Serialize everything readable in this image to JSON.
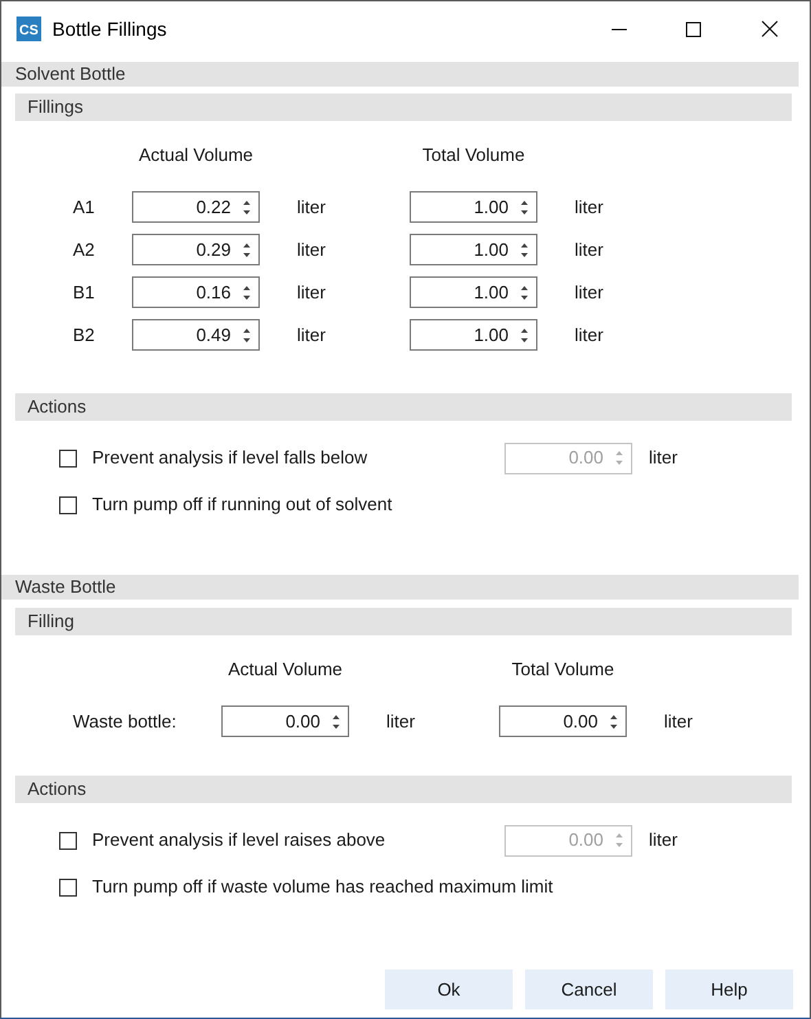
{
  "window": {
    "title": "Bottle Fillings",
    "icon_text": "CS"
  },
  "sections": [
    {
      "title": "Solvent Bottle",
      "filling": {
        "title": "Fillings",
        "kind": "compact",
        "columns": [
          "Actual Volume",
          "Total Volume"
        ],
        "rows": [
          {
            "label": "A1",
            "actual": "0.22",
            "actual_unit": "liter",
            "total": "1.00",
            "total_unit": "liter"
          },
          {
            "label": "A2",
            "actual": "0.29",
            "actual_unit": "liter",
            "total": "1.00",
            "total_unit": "liter"
          },
          {
            "label": "B1",
            "actual": "0.16",
            "actual_unit": "liter",
            "total": "1.00",
            "total_unit": "liter"
          },
          {
            "label": "B2",
            "actual": "0.49",
            "actual_unit": "liter",
            "total": "1.00",
            "total_unit": "liter"
          }
        ]
      },
      "actions": {
        "title": "Actions",
        "items": [
          {
            "kind": "threshold",
            "label": "Prevent analysis if level falls below",
            "checked": false,
            "value": "0.00",
            "disabled": true,
            "unit": "liter"
          },
          {
            "kind": "plain",
            "label": "Turn pump off if running out of solvent",
            "checked": false
          }
        ]
      }
    },
    {
      "title": "Waste Bottle",
      "filling": {
        "title": "Filling",
        "kind": "wide",
        "columns": [
          "Actual Volume",
          "Total Volume"
        ],
        "rows": [
          {
            "label": "Waste bottle:",
            "actual": "0.00",
            "actual_unit": "liter",
            "total": "0.00",
            "total_unit": "liter"
          }
        ]
      },
      "actions": {
        "title": "Actions",
        "items": [
          {
            "kind": "threshold",
            "label": "Prevent analysis if level raises above",
            "checked": false,
            "value": "0.00",
            "disabled": true,
            "unit": "liter"
          },
          {
            "kind": "plain",
            "label": "Turn pump off if waste volume has reached maximum limit",
            "checked": false
          }
        ]
      }
    }
  ],
  "buttons": [
    "Ok",
    "Cancel",
    "Help"
  ]
}
